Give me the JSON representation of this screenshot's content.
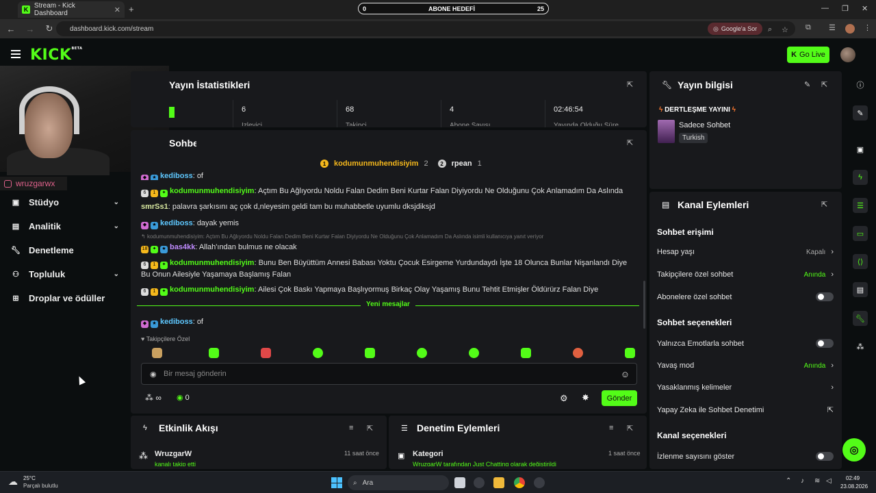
{
  "browser": {
    "tab_title": "Stream - Kick Dashboard",
    "url": "dashboard.kick.com/stream",
    "google_label": "Google'a Sor"
  },
  "goal": {
    "left": "0",
    "title": "ABONE HEDEFİ",
    "right": "25"
  },
  "header": {
    "logo": "KICK",
    "beta": "BETA",
    "go_live": "Go Live"
  },
  "webcam": {
    "instagram": "wruzgarwx"
  },
  "sidebar": {
    "items": [
      {
        "label": "Stüdyo",
        "icon": "studio-icon",
        "has_chevron": true
      },
      {
        "label": "Analitik",
        "icon": "analytics-icon",
        "has_chevron": true
      },
      {
        "label": "Denetleme",
        "icon": "wrench-icon",
        "has_chevron": false
      },
      {
        "label": "Topluluk",
        "icon": "community-icon",
        "has_chevron": true
      },
      {
        "label": "Droplar ve ödüller",
        "icon": "drops-icon",
        "has_chevron": false
      }
    ]
  },
  "stats": {
    "title": "Yayın İstatistikleri",
    "items": [
      {
        "value": "6",
        "label": "İzleyici"
      },
      {
        "value": "68",
        "label": "Takipçi"
      },
      {
        "value": "4",
        "label": "Abone Sayısı"
      },
      {
        "value": "02:46:54",
        "label": "Yayında Olduğu Süre"
      }
    ]
  },
  "chat": {
    "title": "Sohbet",
    "top_gifters": [
      {
        "rank": "1",
        "name": "kodumunmuhendisiyim",
        "count": "2"
      },
      {
        "rank": "2",
        "name": "rpean",
        "count": "1"
      }
    ],
    "messages": [
      {
        "user": "kediboss",
        "color": "#5ec8ff",
        "text": "of"
      },
      {
        "user": "kodumunmuhendisiyim",
        "color": "#53fc18",
        "text": "Açtım Bu Ağlıyordu Noldu Falan Dedim Beni Kurtar Falan Diyiyordu Ne Olduğunu Çok Anlamadım Da Aslında"
      },
      {
        "user": "smrSs1",
        "color": "#d8e8a0",
        "text": "palavra şarkısını aç çok d,nleyesim geldi tam bu muhabbetle uyumlu dksjdiksjd"
      },
      {
        "user": "kediboss",
        "color": "#5ec8ff",
        "text": "dayak yemis"
      },
      {
        "user": "bas4kk",
        "color": "#c08cff",
        "text": "Allah'ından bulmus ne olacak",
        "reply": "kodumunmuhendisiyim: Açtım Bu Ağlıyordu Noldu Falan Dedim Beni Kurtar Falan Diyiyordu Ne Olduğunu Çok Anlamadım Da Aslında isimli kullanıcıya yanıt veriyor"
      },
      {
        "user": "kodumunmuhendisiyim",
        "color": "#53fc18",
        "text": "Bunu Ben Büyüttüm Annesi Babası Yoktu Çocuk Esirgeme Yurdundaydı İşte 18 Olunca Bunlar Nişanlandı Diye Bu Onun Ailesiyle Yaşamaya Başlamış Falan"
      },
      {
        "user": "kodumunmuhendisiyim",
        "color": "#53fc18",
        "text": "Ailesi Çok Baskı Yapmaya Başlıyormuş Birkaç Olay Yaşamış Bunu Tehtit Etmişler Öldürürz Falan Diye"
      },
      {
        "user": "kediboss",
        "color": "#5ec8ff",
        "text": "of"
      }
    ],
    "new_messages": "Yeni mesajlar",
    "followers_only": "Takipçilere Özel",
    "input_placeholder": "Bir mesaj gönderin",
    "points": "∞",
    "kicks": "0",
    "send": "Gönder"
  },
  "events": {
    "title": "Etkinlik Akışı",
    "item": {
      "user": "WruzgarW",
      "sub": "kanalı takip etti",
      "time": "11 saat önce"
    }
  },
  "moderation": {
    "title": "Denetim Eylemleri",
    "item": {
      "label": "Kategori",
      "sub": "WruzgarW tarafından Just Chatting olarak değiştirildi",
      "time": "1 saat önce"
    }
  },
  "stream_info": {
    "title": "Yayın bilgisi",
    "stream_title": "DERTLEŞME YAYINI",
    "category": "Sadece Sohbet",
    "language": "Turkish"
  },
  "channel_actions": {
    "title": "Kanal Eylemleri",
    "chat_access": "Sohbet erişimi",
    "account_age": {
      "label": "Hesap yaşı",
      "value": "Kapalı"
    },
    "followers_chat": {
      "label": "Takipçilere özel sohbet",
      "value": "Anında"
    },
    "subs_chat": {
      "label": "Abonelere özel sohbet"
    },
    "chat_options": "Sohbet seçenekleri",
    "emote_only": {
      "label": "Yalnızca Emotlarla sohbet"
    },
    "slow_mode": {
      "label": "Yavaş mod",
      "value": "Anında"
    },
    "banned_words": {
      "label": "Yasaklanmış kelimeler"
    },
    "ai_mod": {
      "label": "Yapay Zeka ile Sohbet Denetimi"
    },
    "channel_options": "Kanal seçenekleri",
    "viewer_count": {
      "label": "İzlenme sayısını göster"
    }
  },
  "taskbar": {
    "weather_temp": "25°C",
    "weather_desc": "Parçalı bulutlu",
    "search": "Ara",
    "time": "02:49",
    "date": "23.08.2026"
  },
  "colors": {
    "accent": "#53fc18",
    "bg": "#0b0e0f",
    "panel": "#18191c"
  }
}
